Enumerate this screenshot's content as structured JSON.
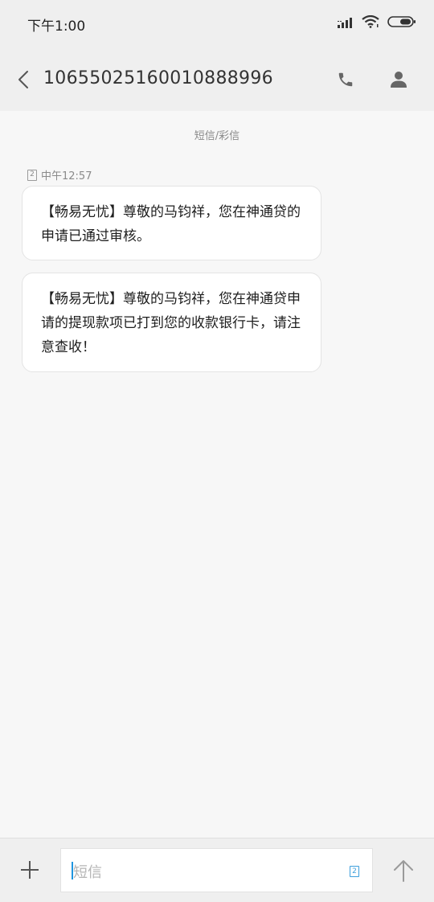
{
  "status_bar": {
    "time": "下午1:00",
    "icons": [
      "signal-icon",
      "wifi-icon",
      "battery-icon"
    ]
  },
  "header": {
    "title": "10655025160010888996",
    "icons": [
      "back-icon",
      "phone-icon",
      "contact-icon"
    ]
  },
  "conversation": {
    "channel_label": "短信/彩信",
    "sim_slot": "2",
    "timestamp": "中午12:57",
    "messages": [
      {
        "text": "【畅易无忧】尊敬的马钧祥，您在神通贷的申请已通过审核。"
      },
      {
        "text": "【畅易无忧】尊敬的马钧祥，您在神通贷申请的提现款项已打到您的收款银行卡，请注意查收！"
      }
    ]
  },
  "compose": {
    "placeholder": "短信",
    "sim_slot": "2",
    "icons": [
      "plus-icon",
      "send-arrow-icon"
    ]
  },
  "colors": {
    "background": "#f7f7f7",
    "bar_background": "#efefef",
    "bubble": "#ffffff",
    "accent": "#1f96e0"
  }
}
